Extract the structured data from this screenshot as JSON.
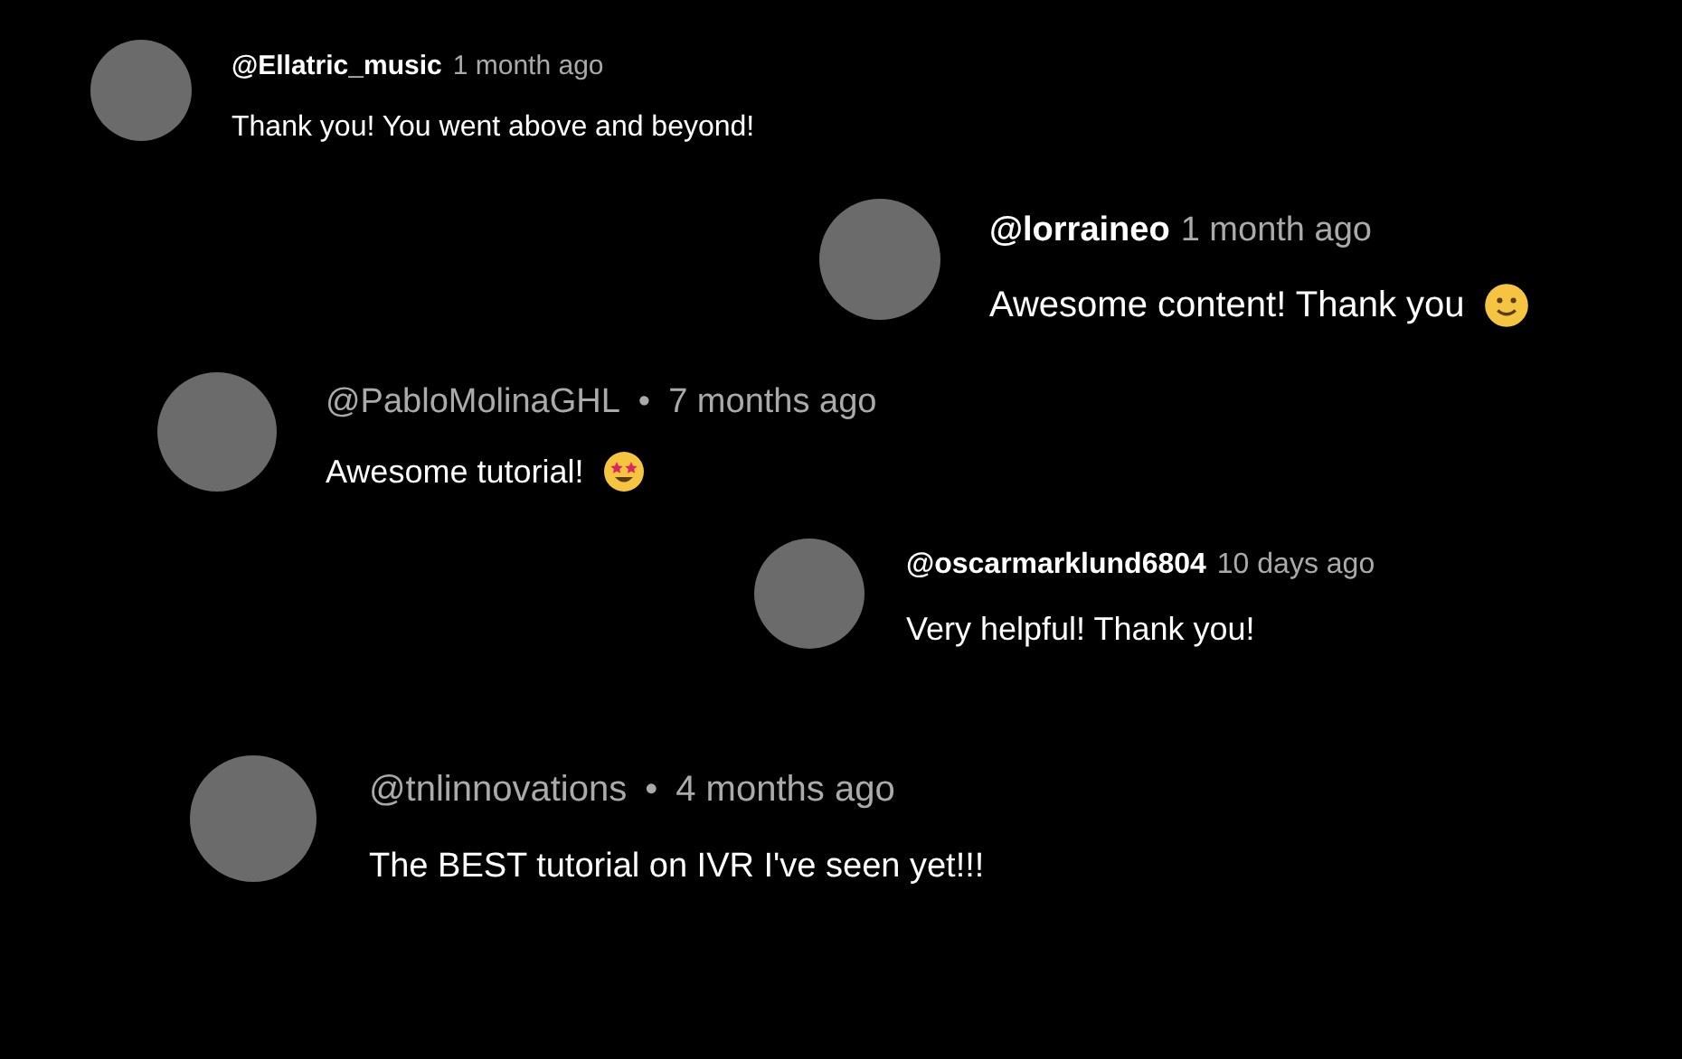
{
  "comments": [
    {
      "kind": "bold",
      "handle": "@Ellatric_music",
      "time": "1 month ago",
      "text": "Thank you! You went above and beyond!"
    },
    {
      "kind": "bold",
      "handle": "@lorraineo",
      "time": "1 month ago",
      "text": "Awesome content! Thank you",
      "emoji": {
        "kind": "smile"
      }
    },
    {
      "kind": "dot",
      "handle": "@PabloMolinaGHL",
      "separator": "•",
      "time": "7 months ago",
      "text": "Awesome tutorial!",
      "emoji": {
        "kind": "star_eyes"
      }
    },
    {
      "kind": "bold",
      "handle": "@oscarmarklund6804",
      "time": "10 days ago",
      "text": "Very helpful! Thank you!"
    },
    {
      "kind": "dot",
      "handle": "@tnlinnovations",
      "separator": "•",
      "time": "4 months ago",
      "text": "The BEST tutorial on IVR I've seen yet!!!"
    }
  ]
}
